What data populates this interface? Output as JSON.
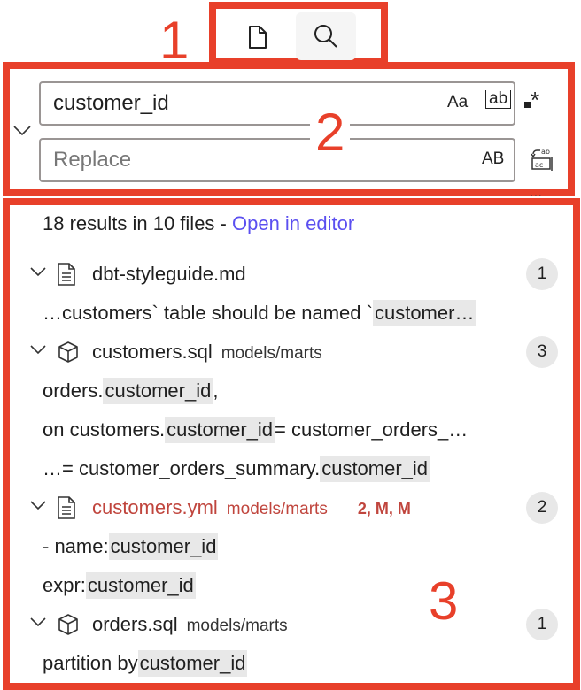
{
  "annotations": [
    "1",
    "2",
    "3"
  ],
  "toolbar": {
    "tabs": [
      {
        "icon": "file-icon"
      },
      {
        "icon": "search-icon",
        "active": true
      }
    ]
  },
  "search": {
    "value": "customer_id",
    "options": [
      "Aa",
      "ab",
      "*"
    ],
    "replace_placeholder": "Replace",
    "preserve_case": "AB"
  },
  "results": {
    "summary": "18 results in 10 files - ",
    "open_in_editor": "Open in editor",
    "files": [
      {
        "name": "dbt-styleguide.md",
        "path": "",
        "icon": "document-icon",
        "count": "1",
        "matches": [
          {
            "pre": "…customers` table should be named `",
            "hl": "customer…"
          }
        ]
      },
      {
        "name": "customers.sql",
        "path": "models/marts",
        "icon": "cube-icon",
        "count": "3",
        "matches": [
          {
            "pre": "orders.",
            "hl": "customer_id",
            "post": ","
          },
          {
            "pre": "on customers.",
            "hl": "customer_id",
            "post": " = customer_orders_…"
          },
          {
            "pre": "…= customer_orders_summary.",
            "hl": "customer_id"
          }
        ]
      },
      {
        "name": "customers.yml",
        "path": "models/marts",
        "status": "2, M, M",
        "icon": "document-icon",
        "count": "2",
        "modified": true,
        "matches": [
          {
            "pre": "- name: ",
            "hl": "customer_id"
          },
          {
            "pre": "expr: ",
            "hl": "customer_id"
          }
        ]
      },
      {
        "name": "orders.sql",
        "path": "models/marts",
        "icon": "cube-icon",
        "count": "1",
        "matches": [
          {
            "pre": "partition by ",
            "hl": "customer_id"
          }
        ]
      }
    ]
  },
  "colors": {
    "annotation": "#e8402a",
    "modified": "#c0453d",
    "link": "#5b4ff0",
    "highlight": "#e8e8e8"
  }
}
